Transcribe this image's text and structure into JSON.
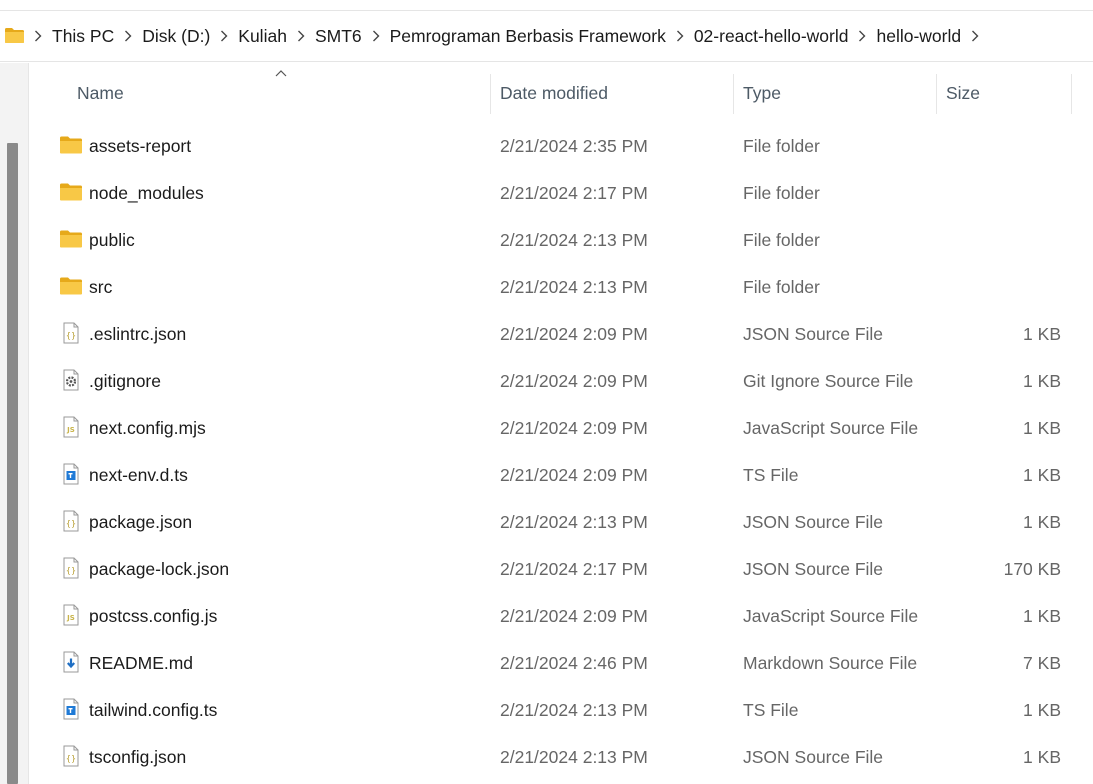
{
  "breadcrumb": {
    "items": [
      "This PC",
      "Disk (D:)",
      "Kuliah",
      "SMT6",
      "Pemrograman Berbasis Framework",
      "02-react-hello-world",
      "hello-world"
    ]
  },
  "columns": {
    "name": "Name",
    "date": "Date modified",
    "type": "Type",
    "size": "Size"
  },
  "files": [
    {
      "name": "assets-report",
      "date": "2/21/2024 2:35 PM",
      "type": "File folder",
      "size": "",
      "icon": "folder-icon"
    },
    {
      "name": "node_modules",
      "date": "2/21/2024 2:17 PM",
      "type": "File folder",
      "size": "",
      "icon": "folder-icon"
    },
    {
      "name": "public",
      "date": "2/21/2024 2:13 PM",
      "type": "File folder",
      "size": "",
      "icon": "folder-icon"
    },
    {
      "name": "src",
      "date": "2/21/2024 2:13 PM",
      "type": "File folder",
      "size": "",
      "icon": "folder-icon"
    },
    {
      "name": ".eslintrc.json",
      "date": "2/21/2024 2:09 PM",
      "type": "JSON Source File",
      "size": "1 KB",
      "icon": "json-file-icon"
    },
    {
      "name": ".gitignore",
      "date": "2/21/2024 2:09 PM",
      "type": "Git Ignore Source File",
      "size": "1 KB",
      "icon": "gear-file-icon"
    },
    {
      "name": "next.config.mjs",
      "date": "2/21/2024 2:09 PM",
      "type": "JavaScript Source File",
      "size": "1 KB",
      "icon": "js-file-icon"
    },
    {
      "name": "next-env.d.ts",
      "date": "2/21/2024 2:09 PM",
      "type": "TS File",
      "size": "1 KB",
      "icon": "ts-file-icon"
    },
    {
      "name": "package.json",
      "date": "2/21/2024 2:13 PM",
      "type": "JSON Source File",
      "size": "1 KB",
      "icon": "json-file-icon"
    },
    {
      "name": "package-lock.json",
      "date": "2/21/2024 2:17 PM",
      "type": "JSON Source File",
      "size": "170 KB",
      "icon": "json-file-icon"
    },
    {
      "name": "postcss.config.js",
      "date": "2/21/2024 2:09 PM",
      "type": "JavaScript Source File",
      "size": "1 KB",
      "icon": "js-file-icon"
    },
    {
      "name": "README.md",
      "date": "2/21/2024 2:46 PM",
      "type": "Markdown Source File",
      "size": "7 KB",
      "icon": "markdown-file-icon"
    },
    {
      "name": "tailwind.config.ts",
      "date": "2/21/2024 2:13 PM",
      "type": "TS File",
      "size": "1 KB",
      "icon": "ts-file-icon"
    },
    {
      "name": "tsconfig.json",
      "date": "2/21/2024 2:13 PM",
      "type": "JSON Source File",
      "size": "1 KB",
      "icon": "json-file-icon"
    }
  ],
  "colors": {
    "folder": "#f8c846",
    "folder_dark": "#e6a91a",
    "header_text": "#4d5a66",
    "ts_blue": "#1f7ad6",
    "js_yellow": "#c9b44a"
  }
}
